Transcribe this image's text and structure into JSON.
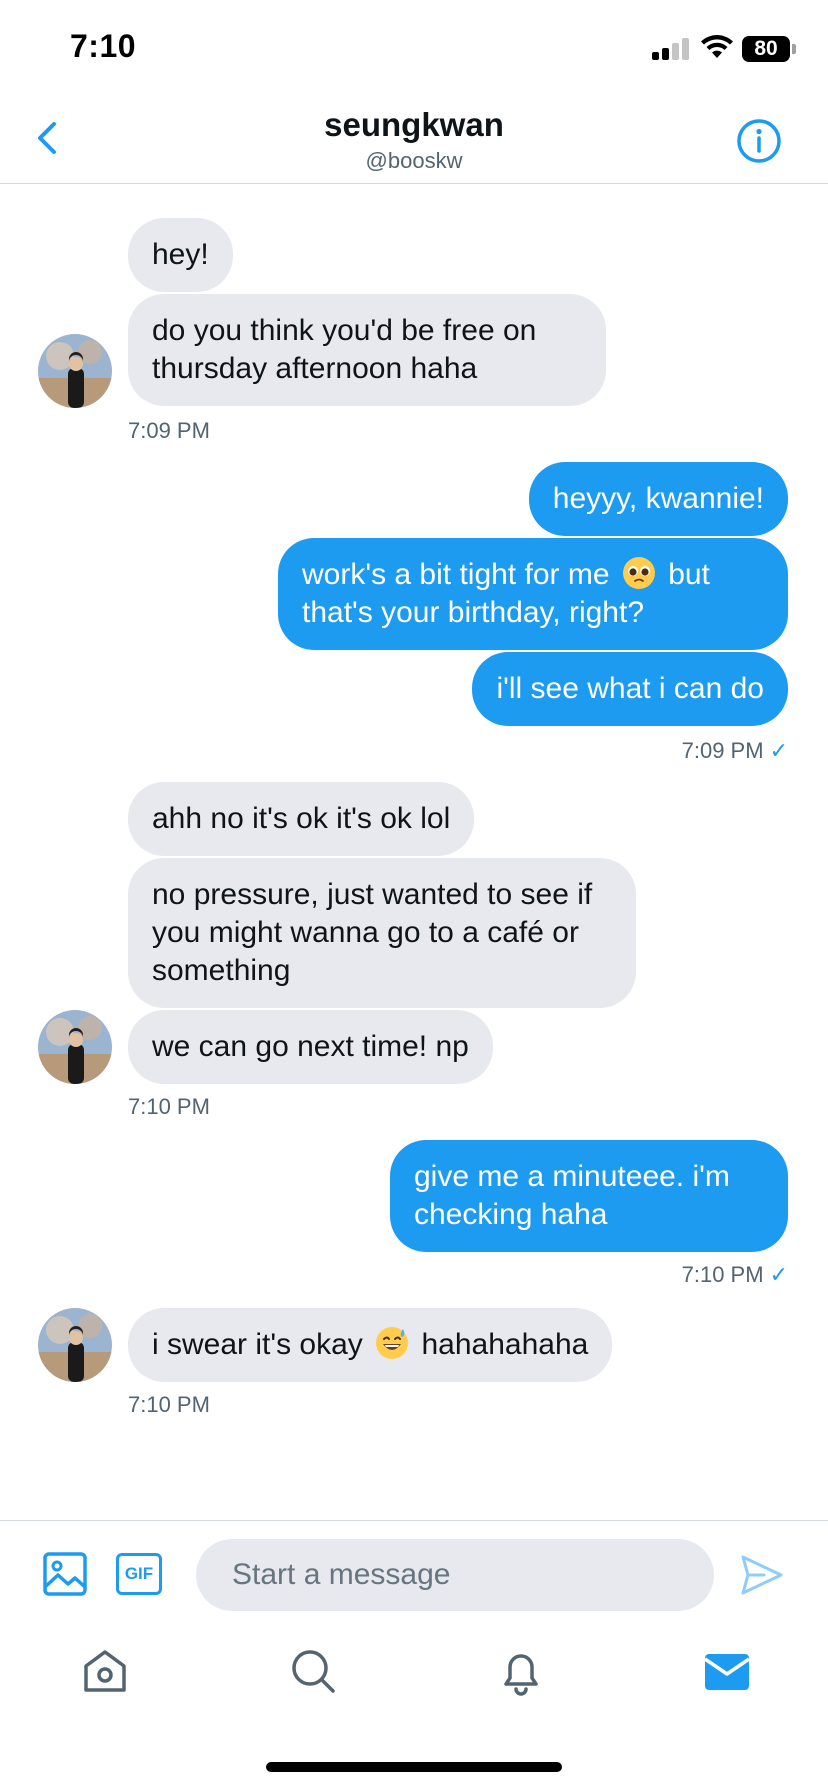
{
  "status_bar": {
    "time": "7:10",
    "battery": "80"
  },
  "header": {
    "name": "seungkwan",
    "handle": "@booskw"
  },
  "messages": {
    "g1_m1": "hey!",
    "g1_m2": "do you think you'd be free on thursday afternoon haha",
    "g1_time": "7:09 PM",
    "g2_m1": "heyyy, kwannie!",
    "g2_m2a": "work's a bit tight for me",
    "g2_m2b": "but that's your birthday, right?",
    "g2_m3": "i'll see what i can do",
    "g2_time": "7:09 PM",
    "g3_m1": "ahh no it's ok it's ok lol",
    "g3_m2": "no pressure, just wanted to see if you might wanna go to a café or something",
    "g3_m3": "we can go next time! np",
    "g3_time": "7:10 PM",
    "g4_m1": "give me a minuteee. i'm checking haha",
    "g4_time": "7:10 PM",
    "g5_m1a": "i swear it's okay",
    "g5_m1b": "hahahahaha",
    "g5_time": "7:10 PM",
    "read_check": "✓"
  },
  "composer": {
    "gif_label": "GIF",
    "placeholder": "Start a message"
  },
  "icons": {
    "back": "chevron-left-icon",
    "info": "info-icon",
    "image": "image-icon",
    "send": "send-icon",
    "home": "home-icon",
    "search": "search-icon",
    "notifications": "bell-icon",
    "messages": "mail-icon"
  },
  "colors": {
    "accent": "#1d9bf0",
    "incoming_bubble": "#e7e9ee",
    "secondary_text": "#536471"
  }
}
